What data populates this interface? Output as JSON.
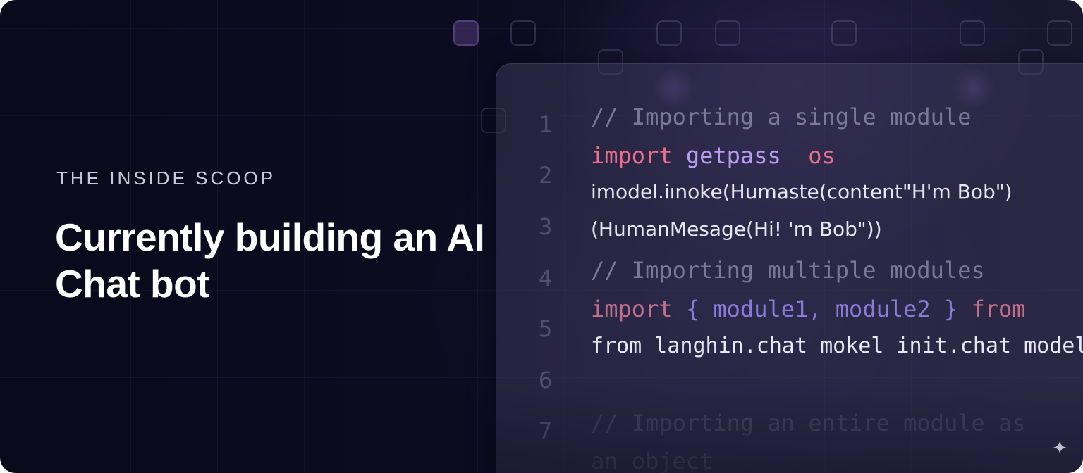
{
  "banner": {
    "eyebrow": "THE INSIDE SCOOP",
    "headline": "Currently building an AI Chat bot"
  },
  "code_editor": {
    "line_numbers": [
      "1",
      "2",
      "3",
      "4",
      "5",
      "6",
      "7"
    ],
    "lines": [
      {
        "comment": "// Importing a single module"
      },
      {
        "keyword": "import",
        "name": "getpass",
        "extra": "os"
      },
      {
        "text": "imodel.iınoke(Humaste(content\"H'm Bob\")"
      },
      {
        "text": "(HumanMesage(Hi! 'm Bob\"))"
      },
      {
        "comment": "// Importing multiple modules"
      },
      {
        "keyword": "import",
        "brace_open": "{",
        "names": "module1, module2",
        "brace_close": "}",
        "keyword2": "from"
      },
      {
        "text": "from langhin.chat mokel init.chat model"
      },
      {
        "comment": "// Importing an entire module as"
      },
      {
        "comment": "an object"
      }
    ]
  },
  "icons": {
    "sparkle": "sparkle-icon"
  },
  "colors": {
    "background": "#0a0a1c",
    "keyword": "#e8708a",
    "identifier": "#b79cf0",
    "text": "#e8e6f2"
  }
}
